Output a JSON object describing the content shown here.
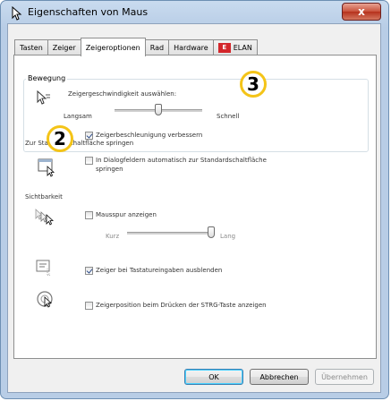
{
  "window": {
    "title": "Eigenschaften von Maus",
    "close_label": "x"
  },
  "tabs": [
    {
      "label": "Tasten"
    },
    {
      "label": "Zeiger"
    },
    {
      "label": "Zeigeroptionen"
    },
    {
      "label": "Rad"
    },
    {
      "label": "Hardware"
    },
    {
      "label": "ELAN"
    }
  ],
  "motion": {
    "group_label": "Bewegung",
    "speed_label": "Zeigergeschwindigkeit auswählen:",
    "slow_label": "Langsam",
    "fast_label": "Schnell",
    "speed_value": 0.5,
    "accel_label": "Zeigerbeschleunigung verbessern",
    "accel_checked": true
  },
  "snap": {
    "group_label": "Zur Standardschaltfläche springen",
    "option_line1": "In Dialogfeldern automatisch zur Standardschaltfläche",
    "option_line2": "springen",
    "checked": false
  },
  "visibility": {
    "group_label": "Sichtbarkeit",
    "trails_label": "Mausspur anzeigen",
    "trails_checked": false,
    "short_label": "Kurz",
    "long_label": "Lang",
    "trails_value": 1.0,
    "hide_label": "Zeiger bei Tastatureingaben ausblenden",
    "hide_checked": true,
    "ctrl_label": "Zeigerposition beim Drücken der STRG-Taste anzeigen",
    "ctrl_checked": false
  },
  "annotations": {
    "badge_speed": "3",
    "badge_accel": "2"
  },
  "buttons": {
    "ok": "OK",
    "cancel": "Abbrechen",
    "apply": "Übernehmen"
  },
  "colors": {
    "badge_ring": "#f4c418",
    "close_button": "#c8523b"
  }
}
